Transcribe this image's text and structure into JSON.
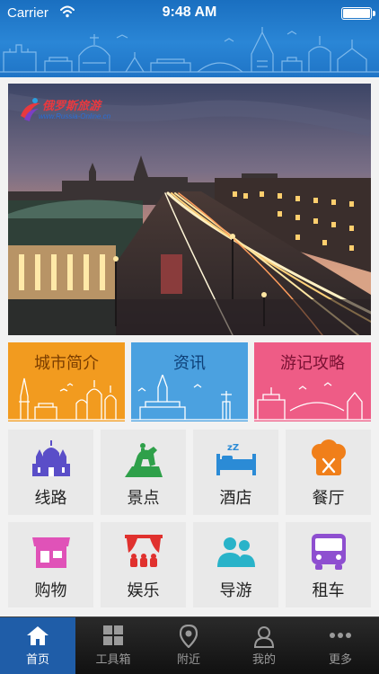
{
  "status_bar": {
    "carrier": "Carrier",
    "time": "9:48 AM"
  },
  "banner": {
    "logo_text": "俄罗斯旅游",
    "logo_url": "www.Russia-Online.cn"
  },
  "categories": [
    {
      "label": "城市简介",
      "color": "#f29b1f"
    },
    {
      "label": "资讯",
      "color": "#4ba1e0"
    },
    {
      "label": "游记攻略",
      "color": "#ee5c86"
    }
  ],
  "grid": [
    {
      "label": "线路",
      "icon": "kremlin-icon"
    },
    {
      "label": "景点",
      "icon": "horseman-statue-icon"
    },
    {
      "label": "酒店",
      "icon": "bed-icon"
    },
    {
      "label": "餐厅",
      "icon": "chef-hat-icon"
    },
    {
      "label": "购物",
      "icon": "shop-icon"
    },
    {
      "label": "娱乐",
      "icon": "theater-icon"
    },
    {
      "label": "导游",
      "icon": "guide-people-icon"
    },
    {
      "label": "租车",
      "icon": "bus-icon"
    }
  ],
  "tabs": [
    {
      "label": "首页",
      "icon": "home-icon",
      "active": true
    },
    {
      "label": "工具箱",
      "icon": "toolbox-icon",
      "active": false
    },
    {
      "label": "附近",
      "icon": "location-pin-icon",
      "active": false
    },
    {
      "label": "我的",
      "icon": "user-icon",
      "active": false
    },
    {
      "label": "更多",
      "icon": "more-dots-icon",
      "active": false
    }
  ]
}
